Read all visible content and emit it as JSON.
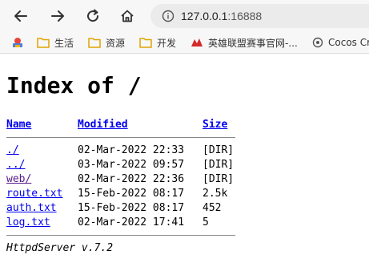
{
  "browser": {
    "url_host": "127.0.0.1",
    "url_port": ":16888",
    "bookmarks": [
      {
        "label": "生活"
      },
      {
        "label": "资源"
      },
      {
        "label": "开发"
      },
      {
        "label": "英雄联盟赛事官网-..."
      },
      {
        "label": "Cocos Cre"
      }
    ]
  },
  "page": {
    "title": "Index of /",
    "columns": {
      "name": "Name",
      "modified": "Modified",
      "size": "Size"
    },
    "rows": [
      {
        "name": "./",
        "modified": "02-Mar-2022 22:33",
        "size": "[DIR]"
      },
      {
        "name": "../",
        "modified": "03-Mar-2022 09:57",
        "size": "[DIR]"
      },
      {
        "name": "web/",
        "modified": "02-Mar-2022 22:36",
        "size": "[DIR]"
      },
      {
        "name": "route.txt",
        "modified": "15-Feb-2022 08:17",
        "size": "2.5k"
      },
      {
        "name": "auth.txt",
        "modified": "15-Feb-2022 08:17",
        "size": "452"
      },
      {
        "name": "log.txt",
        "modified": "02-Mar-2022 17:41",
        "size": "5"
      }
    ],
    "footer": "HttpdServer v.7.2"
  },
  "colors": {
    "link": "#0000ee",
    "visited": "#551a8b",
    "toolbar": "#f7f7f7"
  }
}
